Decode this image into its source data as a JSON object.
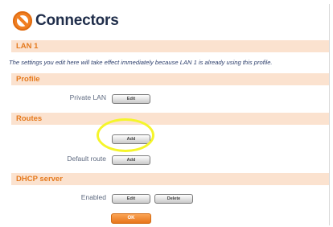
{
  "header": {
    "title": "Connectors",
    "icon": "connectors-logo-icon"
  },
  "sections": {
    "lan": {
      "title": "LAN 1"
    },
    "note": "The settings you edit here will take effect immediately because LAN 1 is already using this profile.",
    "profile": {
      "title": "Profile",
      "label": "Private LAN",
      "edit_label": "Edit"
    },
    "routes": {
      "title": "Routes",
      "add_label": "Add",
      "default_route_label": "Default route",
      "default_add_label": "Add"
    },
    "dhcp": {
      "title": "DHCP server",
      "label": "Enabled",
      "edit_label": "Edit",
      "delete_label": "Delete"
    }
  },
  "footer": {
    "ok_label": "OK"
  },
  "colors": {
    "accent": "#f07f22",
    "section_bg": "#fbe2cf",
    "highlight": "#f5f52a"
  }
}
